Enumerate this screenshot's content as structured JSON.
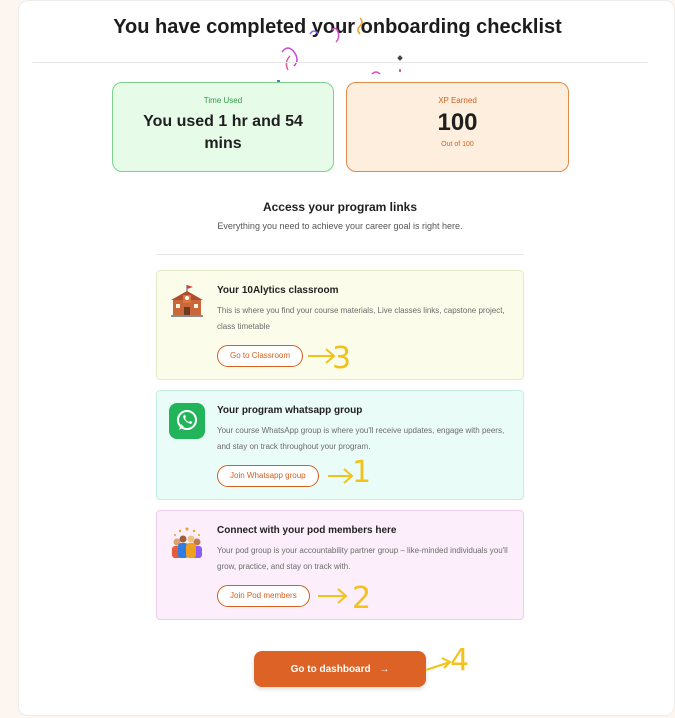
{
  "header": {
    "title": "You have completed your onboarding checklist"
  },
  "stats": {
    "time": {
      "label": "Time Used",
      "value": "You used 1 hr and 54 mins"
    },
    "xp": {
      "label": "XP Earned",
      "value": "100",
      "sub": "Out of 100"
    }
  },
  "section": {
    "title": "Access your program links",
    "subtitle": "Everything you need to achieve your career goal is right here."
  },
  "links": [
    {
      "icon": "school-building-icon",
      "title": "Your 10Alytics classroom",
      "description": "This is where you find your course materials, Live classes links, capstone project, class timetable",
      "button": "Go to Classroom",
      "annotation": "3"
    },
    {
      "icon": "whatsapp-icon",
      "title": "Your program whatsapp group",
      "description": "Your course WhatsApp group is where you'll receive updates, engage with peers, and stay on track throughout your program.",
      "button": "Join Whatsapp group",
      "annotation": "1"
    },
    {
      "icon": "people-group-icon",
      "title": "Connect with your pod members here",
      "description": "Your pod group is your accountability partner group – like-minded individuals you'll grow, practice, and stay on track with.",
      "button": "Join Pod members",
      "annotation": "2"
    }
  ],
  "footer": {
    "dashboard_button": "Go to dashboard",
    "arrow": "→",
    "annotation": "4"
  },
  "colors": {
    "accent": "#dc6226",
    "green_border": "#7fd08e",
    "annotation": "#f2c21a"
  }
}
